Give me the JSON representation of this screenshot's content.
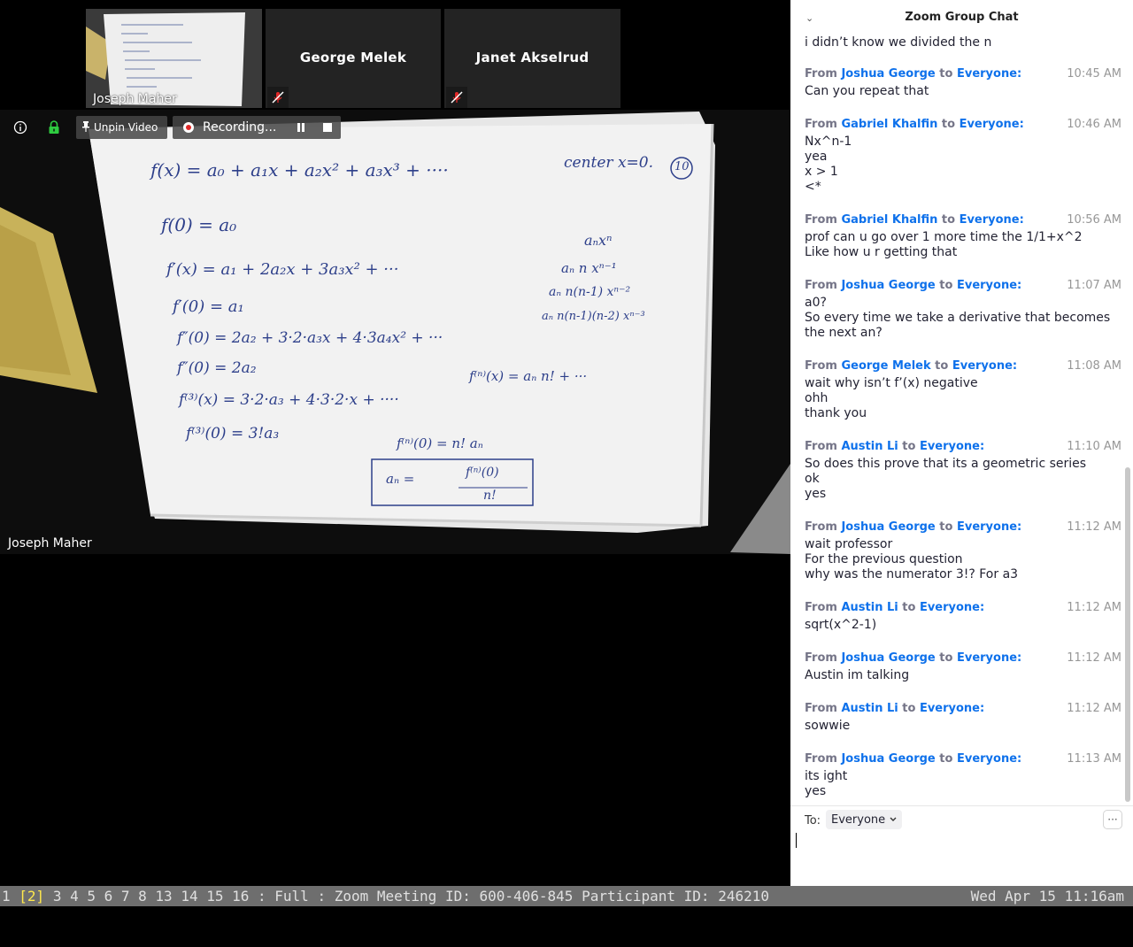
{
  "participants": {
    "self_name": "Joseph Maher",
    "thumbnails": [
      {
        "name": "George Melek",
        "muted": true
      },
      {
        "name": "Janet Akselrud",
        "muted": true
      }
    ]
  },
  "main_video": {
    "speaker_name": "Joseph Maher"
  },
  "toolbar": {
    "unpin_label": "Unpin Video",
    "recording_label": "Recording...",
    "info_icon": "info-icon",
    "security_icon": "lock-icon"
  },
  "chat": {
    "title": "Zoom Group Chat",
    "truncated_top_line": "i didn’t know we divided the n",
    "from_word": "From",
    "to_word": "to",
    "messages": [
      {
        "sender": "Joshua George",
        "recipient": "Everyone:",
        "time": "10:45 AM",
        "lines": [
          "Can you repeat that"
        ]
      },
      {
        "sender": "Gabriel Khalfin",
        "recipient": "Everyone:",
        "time": "10:46 AM",
        "lines": [
          "Nx^n-1",
          "yea",
          "x > 1",
          "<*"
        ]
      },
      {
        "sender": "Gabriel Khalfin",
        "recipient": "Everyone:",
        "time": "10:56 AM",
        "lines": [
          "prof can u go over 1 more time the 1/1+x^2",
          "Like how u r getting that"
        ]
      },
      {
        "sender": "Joshua George",
        "recipient": "Everyone:",
        "time": "11:07 AM",
        "lines": [
          "a0?",
          "So every time we take a derivative that becomes",
          "the next an?"
        ]
      },
      {
        "sender": "George Melek",
        "recipient": "Everyone:",
        "time": "11:08 AM",
        "lines": [
          "wait why isn’t f’(x) negative",
          "ohh",
          "thank you"
        ]
      },
      {
        "sender": "Austin Li",
        "recipient": "Everyone:",
        "time": "11:10 AM",
        "lines": [
          "So does this prove that its a geometric series",
          "ok",
          "yes"
        ]
      },
      {
        "sender": "Joshua George",
        "recipient": "Everyone:",
        "time": "11:12 AM",
        "lines": [
          "wait professor",
          "For the previous question",
          "why was the numerator 3!? For a3"
        ]
      },
      {
        "sender": "Austin Li",
        "recipient": "Everyone:",
        "time": "11:12 AM",
        "lines": [
          "sqrt(x^2-1)"
        ]
      },
      {
        "sender": "Joshua George",
        "recipient": "Everyone:",
        "time": "11:12 AM",
        "lines": [
          "Austin im talking"
        ]
      },
      {
        "sender": "Austin Li",
        "recipient": "Everyone:",
        "time": "11:12 AM",
        "lines": [
          "sowwie"
        ]
      },
      {
        "sender": "Joshua George",
        "recipient": "Everyone:",
        "time": "11:13 AM",
        "lines": [
          "its ight",
          "yes"
        ]
      }
    ],
    "to_label": "To:",
    "to_value": "Everyone",
    "more_label": "···"
  },
  "statusbar": {
    "ws_first": "1",
    "ws_active": "[2]",
    "ws_rest": "3 4 5 6 7 8 13 14 15 16 : Full : Zoom Meeting ID: 600-406-845 Participant ID: 246210",
    "datetime": "Wed Apr 15 11:16am"
  },
  "whiteboard": {
    "top_right": "center x=0.",
    "page_number": "10",
    "lines": [
      "f(x) = a₀ + a₁x + a₂x² + a₃x³ + ····",
      "f(0) = a₀",
      "f′(x) = a₁ + 2a₂x + 3a₃x² + ···",
      "f′(0) = a₁",
      "f″(0) = 2a₂ + 3·2·a₃x + 4·3a₄x² + ···",
      "f″(0) = 2a₂",
      "f⁽³⁾(x) = 3·2·a₃ + 4·3·2·x + ····",
      "f⁽³⁾(0) = 3!a₃"
    ],
    "right_lines": [
      "aₙxⁿ",
      "aₙ n xⁿ⁻¹",
      "aₙ n(n-1) xⁿ⁻²",
      "aₙ n(n-1)(n-2) xⁿ⁻³"
    ],
    "fn_x": "f⁽ⁿ⁾(x) = aₙ n! + ···",
    "fn_0": "f⁽ⁿ⁾(0) = n! aₙ",
    "box_lhs": "aₙ =",
    "box_num": "f⁽ⁿ⁾(0)",
    "box_den": "n!"
  }
}
